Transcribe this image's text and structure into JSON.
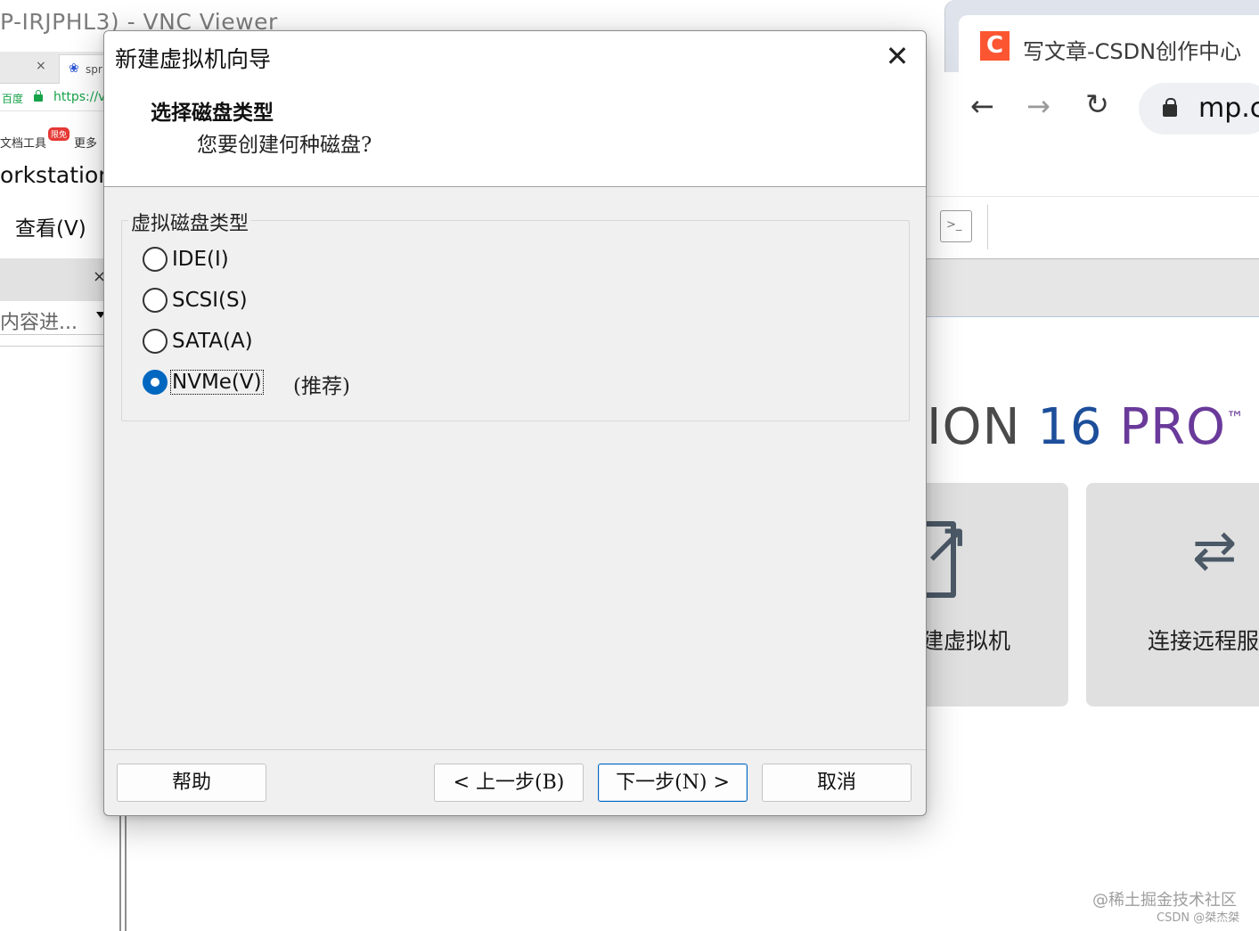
{
  "background_left": {
    "vnc_title": "P-IRJPHL3) - VNC Viewer",
    "tab_close": "×",
    "tab2_label": "spr",
    "addr_baidu": "百度",
    "addr_url": "https://v",
    "bookmark_tools": "文档工具",
    "bookmark_badge": "限免",
    "bookmark_more": "更多",
    "workstation_title": "orkstation",
    "menu_view": "查看(V)",
    "panel_close": "×",
    "search_text": "内容进..."
  },
  "background_right": {
    "tab_title": "写文章-CSDN创作中心",
    "logo_letter": "C",
    "address_url": "mp.c",
    "console_icon_text": ">_",
    "product": {
      "part1": "ION ",
      "part2": "16 ",
      "part3": "PRO",
      "tm": "™"
    },
    "card_create_label": "建虚拟机",
    "card_connect_label": "连接远程服",
    "watermark_1": "@稀土掘金技术社区",
    "watermark_2": "CSDN @桀杰桀"
  },
  "wizard": {
    "title": "新建虚拟机向导",
    "close_symbol": "✕",
    "heading": "选择磁盘类型",
    "subheading": "您要创建何种磁盘?",
    "group_label": "虚拟磁盘类型",
    "options": [
      {
        "label": "IDE(I)",
        "checked": false
      },
      {
        "label": "SCSI(S)",
        "checked": false
      },
      {
        "label": "SATA(A)",
        "checked": false
      },
      {
        "label": "NVMe(V)",
        "checked": true
      }
    ],
    "recommend_note": "(推荐)",
    "buttons": {
      "help": "帮助",
      "back": "< 上一步(B)",
      "next": "下一步(N) >",
      "cancel": "取消"
    }
  },
  "colors": {
    "accent": "#0067c0",
    "csdn_red": "#fc5531",
    "product_blue": "#1d4e9a",
    "product_purple": "#6a3a9a"
  }
}
